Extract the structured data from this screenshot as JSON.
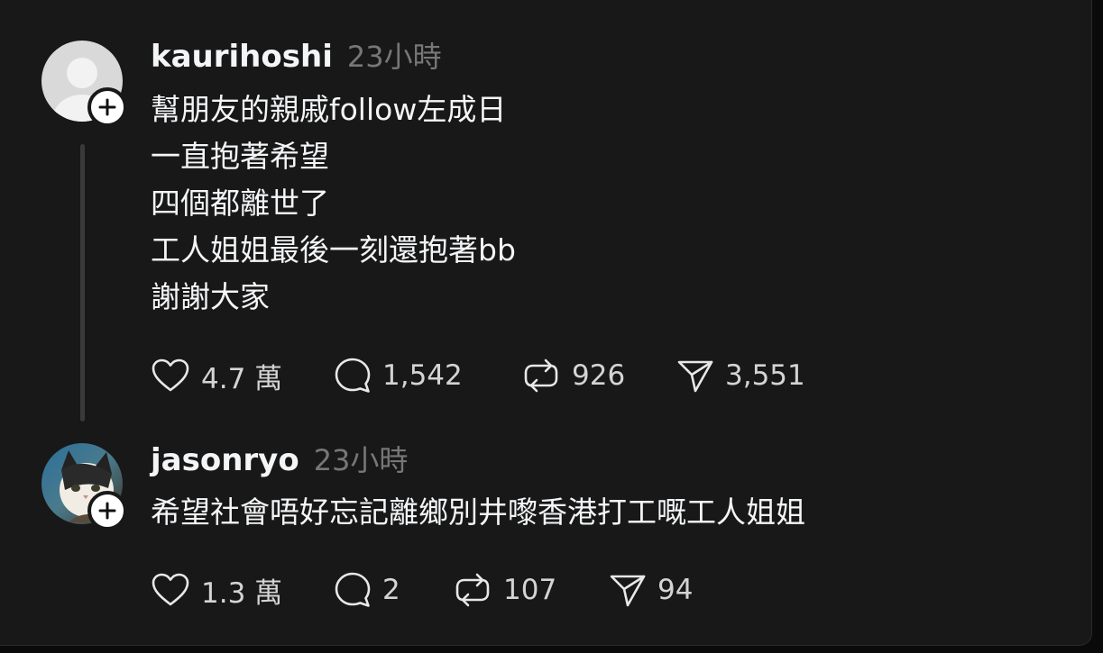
{
  "posts": [
    {
      "username": "kaurihoshi",
      "time": "23小時",
      "lines": [
        "幫朋友的親戚follow左成日",
        "一直抱著希望",
        "四個都離世了",
        "工人姐姐最後一刻還抱著bb",
        "謝謝大家"
      ],
      "likes": "4.7 萬",
      "replies": "1,542",
      "reposts": "926",
      "shares": "3,551"
    },
    {
      "username": "jasonryo",
      "time": "23小時",
      "lines": [
        "希望社會唔好忘記離鄉別井嚟香港打工嘅工人姐姐"
      ],
      "likes": "1.3 萬",
      "replies": "2",
      "reposts": "107",
      "shares": "94"
    }
  ],
  "icons": {
    "like": "heart-icon",
    "reply": "comment-bubble-icon",
    "repost": "repost-icon",
    "share": "send-icon",
    "follow": "plus-icon"
  },
  "colors": {
    "background": "#181818",
    "text": "#f3f5f7",
    "muted": "#777777"
  }
}
